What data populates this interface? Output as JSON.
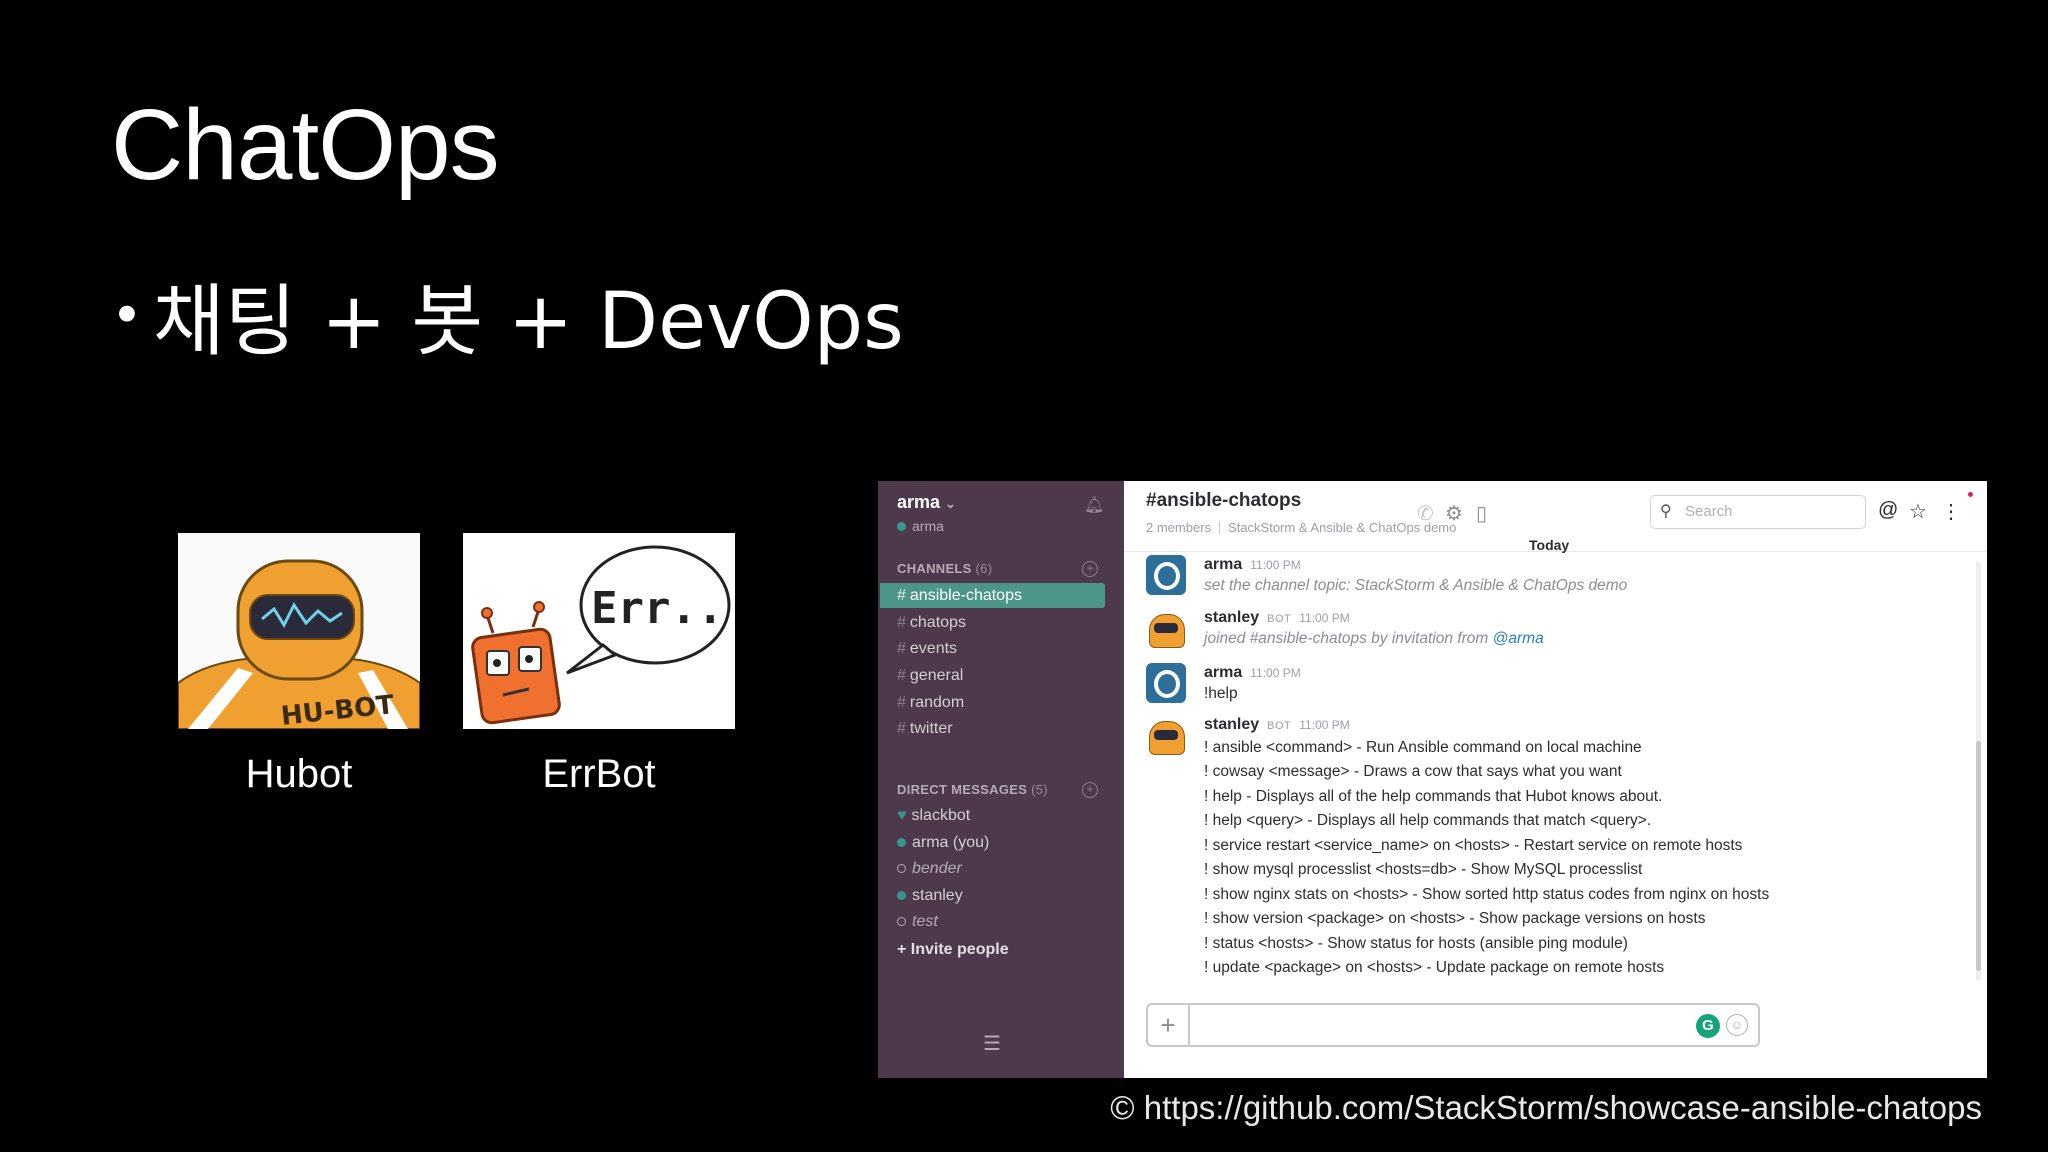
{
  "slide": {
    "title": "ChatOps",
    "bullet_symbol": "•",
    "bullet_text": "채팅 + 봇 + DevOps",
    "credit": "© https://github.com/StackStorm/showcase-ansible-chatops"
  },
  "bots": [
    {
      "caption": "Hubot",
      "image_text": "HU-BOT"
    },
    {
      "caption": "ErrBot",
      "image_text": "Err.."
    }
  ],
  "slack": {
    "sidebar": {
      "team_name": "arma",
      "team_chevron": "⌄",
      "user": "arma",
      "channels_heading": "CHANNELS",
      "channels_count": "(6)",
      "channels": [
        "ansible-chatops",
        "chatops",
        "events",
        "general",
        "random",
        "twitter"
      ],
      "dm_heading": "DIRECT MESSAGES",
      "dm_count": "(5)",
      "dms": [
        "slackbot",
        "arma (you)",
        "bender",
        "stanley",
        "test"
      ],
      "invite": "+ Invite people"
    },
    "header": {
      "channel": "#ansible-chatops",
      "members": "2 members",
      "topic": "StackStorm & Ansible & ChatOps demo",
      "search_placeholder": "Search"
    },
    "day_divider": "Today",
    "messages": [
      {
        "author": "arma",
        "bot": "",
        "time": "11:00 PM",
        "lines": [
          "set the channel topic: StackStorm & Ansible & ChatOps demo"
        ]
      },
      {
        "author": "stanley",
        "bot": "BOT",
        "time": "11:00 PM",
        "lines_prefix": "joined #ansible-chatops by invitation from ",
        "mention": "@arma"
      },
      {
        "author": "arma",
        "bot": "",
        "time": "11:00 PM",
        "lines": [
          "!help"
        ]
      },
      {
        "author": "stanley",
        "bot": "BOT",
        "time": "11:00 PM",
        "lines": [
          "! ansible <command> - Run Ansible command on local machine",
          "! cowsay <message> - Draws a cow that says what you want",
          "! help - Displays all of the help commands that Hubot knows about.",
          "! help <query> - Displays all help commands that match <query>.",
          "! service restart <service_name> on <hosts> - Restart service on remote hosts",
          "! show mysql processlist <hosts=db> - Show MySQL processlist",
          "! show nginx stats on <hosts> - Show sorted http status codes from nginx on hosts",
          "! show version <package> on <hosts> - Show package versions on hosts",
          "! status <hosts> - Show status for hosts (ansible ping module)",
          "! update <package> on <hosts> - Update package on remote hosts"
        ]
      }
    ],
    "composer": {
      "add": "+",
      "grammarly": "G",
      "emoji": "☺"
    }
  }
}
